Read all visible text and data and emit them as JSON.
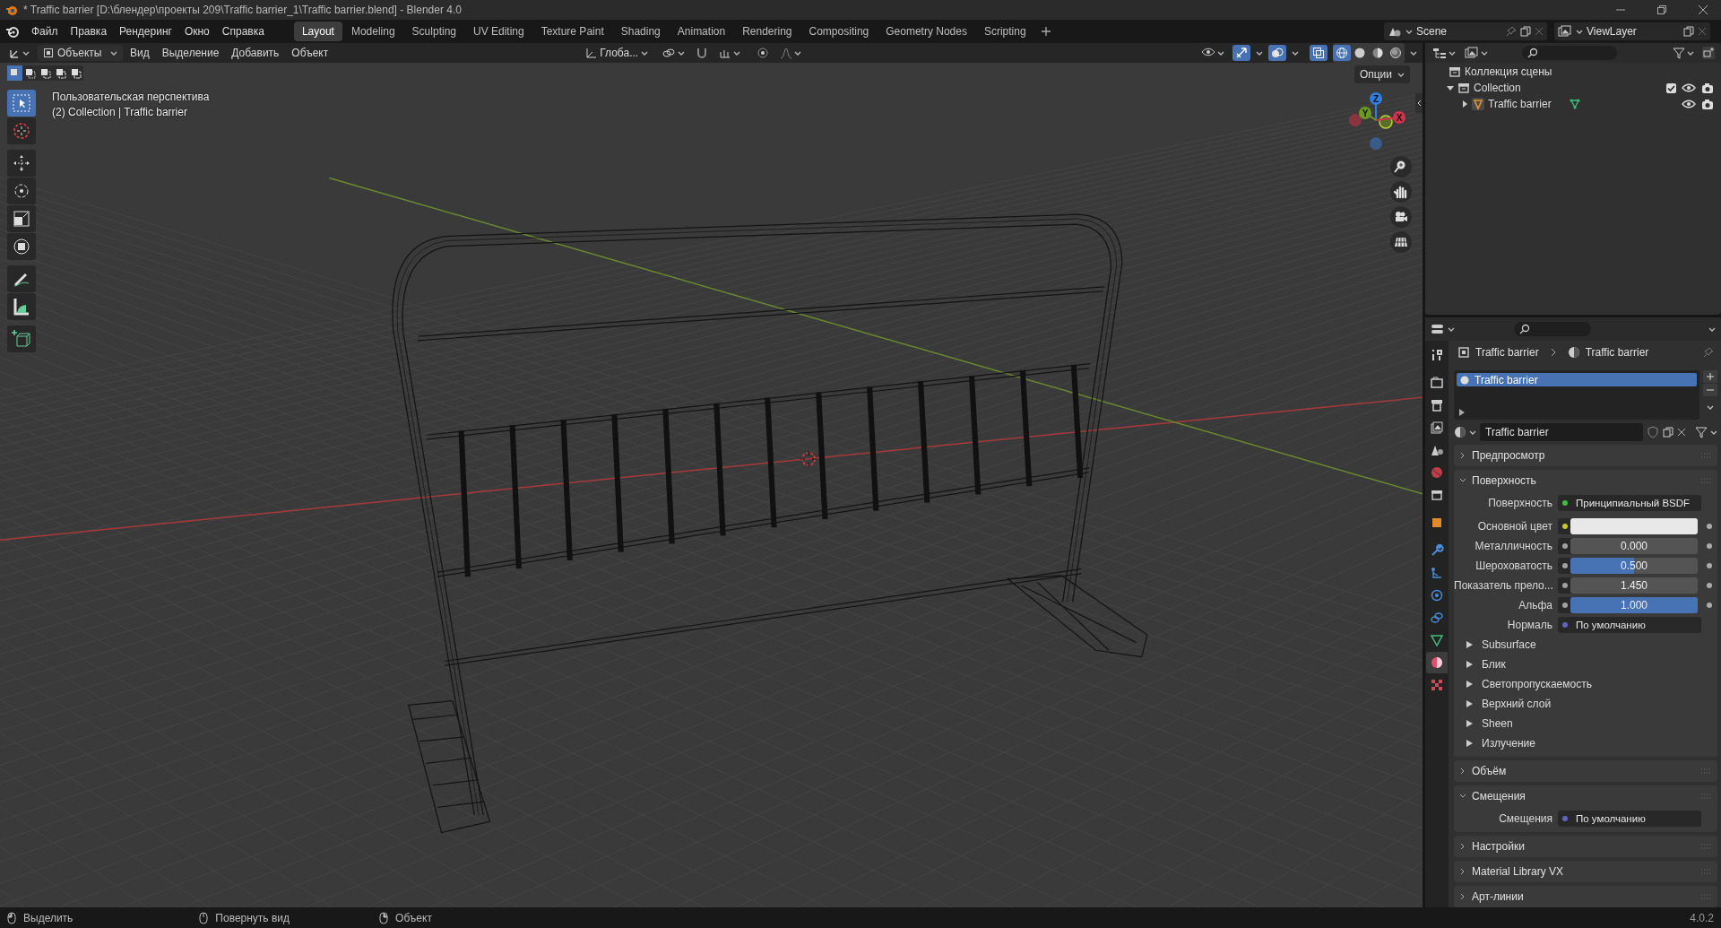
{
  "window": {
    "title": "* Traffic barrier [D:\\блендер\\проекты 209\\Traffic barrier_1\\Traffic barrier.blend] - Blender 4.0"
  },
  "menu": [
    "Файл",
    "Правка",
    "Рендеринг",
    "Окно",
    "Справка"
  ],
  "workspaces": [
    {
      "label": "Layout",
      "selected": true
    },
    {
      "label": "Modeling",
      "selected": false
    },
    {
      "label": "Sculpting",
      "selected": false
    },
    {
      "label": "UV Editing",
      "selected": false
    },
    {
      "label": "Texture Paint",
      "selected": false
    },
    {
      "label": "Shading",
      "selected": false
    },
    {
      "label": "Animation",
      "selected": false
    },
    {
      "label": "Rendering",
      "selected": false
    },
    {
      "label": "Compositing",
      "selected": false
    },
    {
      "label": "Geometry Nodes",
      "selected": false
    },
    {
      "label": "Scripting",
      "selected": false
    }
  ],
  "scene": "Scene",
  "view_layer": "ViewLayer",
  "viewport_header": {
    "mode": "Объекты",
    "menus": [
      "Вид",
      "Выделение",
      "Добавить",
      "Объект"
    ],
    "orientation": "Глоба...",
    "gizmos": true,
    "overlays": true,
    "xray": true,
    "shading": [
      {
        "kind": "wireframe",
        "selected": true
      },
      {
        "kind": "solid",
        "selected": false
      },
      {
        "kind": "material",
        "selected": false
      },
      {
        "kind": "rendered",
        "selected": false
      }
    ]
  },
  "viewport": {
    "view_name": "Пользовательская перспектива",
    "object_info": "(2) Collection | Traffic barrier",
    "options": "Опции",
    "axes": [
      "Z",
      "Y",
      "X"
    ],
    "select_modes": [
      {
        "selected": true
      },
      {
        "selected": false
      },
      {
        "selected": false
      },
      {
        "selected": false
      },
      {
        "selected": false
      }
    ],
    "tools": [
      {
        "kind": "select",
        "selected": true
      },
      {
        "kind": "cursor",
        "selected": false
      },
      {
        "kind": "move",
        "selected": false
      },
      {
        "kind": "rotate",
        "selected": false
      },
      {
        "kind": "scale",
        "selected": false
      },
      {
        "kind": "transform",
        "selected": false
      },
      {
        "kind": "annotate",
        "selected": false
      },
      {
        "kind": "measure",
        "selected": false
      },
      {
        "kind": "add_cube",
        "selected": false
      }
    ]
  },
  "outliner": {
    "root": "Коллекция сцены",
    "items": [
      {
        "label": "Collection",
        "expanded": true,
        "checked": true,
        "children": [
          {
            "label": "Traffic barrier",
            "expanded": false
          }
        ]
      }
    ]
  },
  "properties": {
    "tabs": [
      {
        "kind": "tool",
        "selected": false
      },
      {
        "kind": "render",
        "selected": false
      },
      {
        "kind": "output",
        "selected": false
      },
      {
        "kind": "view_layer",
        "selected": false
      },
      {
        "kind": "scene",
        "selected": false
      },
      {
        "kind": "world",
        "selected": false
      },
      {
        "kind": "collection",
        "selected": false
      },
      {
        "kind": "object",
        "selected": false
      },
      {
        "kind": "modifiers",
        "selected": false
      },
      {
        "kind": "particles",
        "selected": false
      },
      {
        "kind": "physics",
        "selected": false
      },
      {
        "kind": "constraints",
        "selected": false
      },
      {
        "kind": "data",
        "selected": false
      },
      {
        "kind": "material",
        "selected": true
      },
      {
        "kind": "texture",
        "selected": false
      }
    ],
    "breadcrumb": [
      "Traffic barrier",
      "Traffic barrier"
    ],
    "slots": [
      {
        "label": "Traffic barrier",
        "selected": true
      }
    ],
    "material": "Traffic barrier",
    "panels": [
      {
        "title": "Предпросмотр",
        "expanded": false
      },
      {
        "title": "Поверхность",
        "expanded": true,
        "rows": [
          {
            "kind": "link",
            "label": "Поверхность",
            "value": "Принципиальный BSDF",
            "color": "#3fbf3f"
          },
          {
            "kind": "swatch",
            "label": "Основной цвет",
            "color": "#c7c729"
          },
          {
            "kind": "slider",
            "label": "Металличность",
            "value": "0.000",
            "level": 0,
            "color": "#a1a1a1"
          },
          {
            "kind": "slider",
            "label": "Шероховатость",
            "value": "0.500",
            "level": 0.5,
            "color": "#a1a1a1"
          },
          {
            "kind": "slider",
            "label": "Показатель прело...",
            "value": "1.450",
            "level": 0,
            "color": "#a1a1a1"
          },
          {
            "kind": "slider",
            "label": "Альфа",
            "value": "1.000",
            "level": 1,
            "color": "#a1a1a1"
          },
          {
            "kind": "link",
            "label": "Нормаль",
            "value": "По умолчанию",
            "color": "#6363c7"
          },
          {
            "kind": "subpanel",
            "label": "Subsurface",
            "expanded": false
          },
          {
            "kind": "subpanel",
            "label": "Блик",
            "expanded": false
          },
          {
            "kind": "subpanel",
            "label": "Светопропускаемость",
            "expanded": false
          },
          {
            "kind": "subpanel",
            "label": "Верхний слой",
            "expanded": false
          },
          {
            "kind": "subpanel",
            "label": "Sheen",
            "expanded": false
          },
          {
            "kind": "subpanel",
            "label": "Излучение",
            "expanded": false
          }
        ]
      },
      {
        "title": "Объём",
        "expanded": false
      },
      {
        "title": "Смещения",
        "expanded": true,
        "rows": [
          {
            "kind": "link",
            "label": "Смещения",
            "value": "По умолчанию",
            "color": "#6363c7"
          }
        ]
      },
      {
        "title": "Настройки",
        "expanded": false
      },
      {
        "title": "Material Library VX",
        "expanded": false
      },
      {
        "title": "Арт-линии",
        "expanded": false
      }
    ]
  },
  "status_bar": {
    "hints": [
      "Выделить",
      "Повернуть вид",
      "Объект"
    ],
    "version": "4.0.2"
  }
}
